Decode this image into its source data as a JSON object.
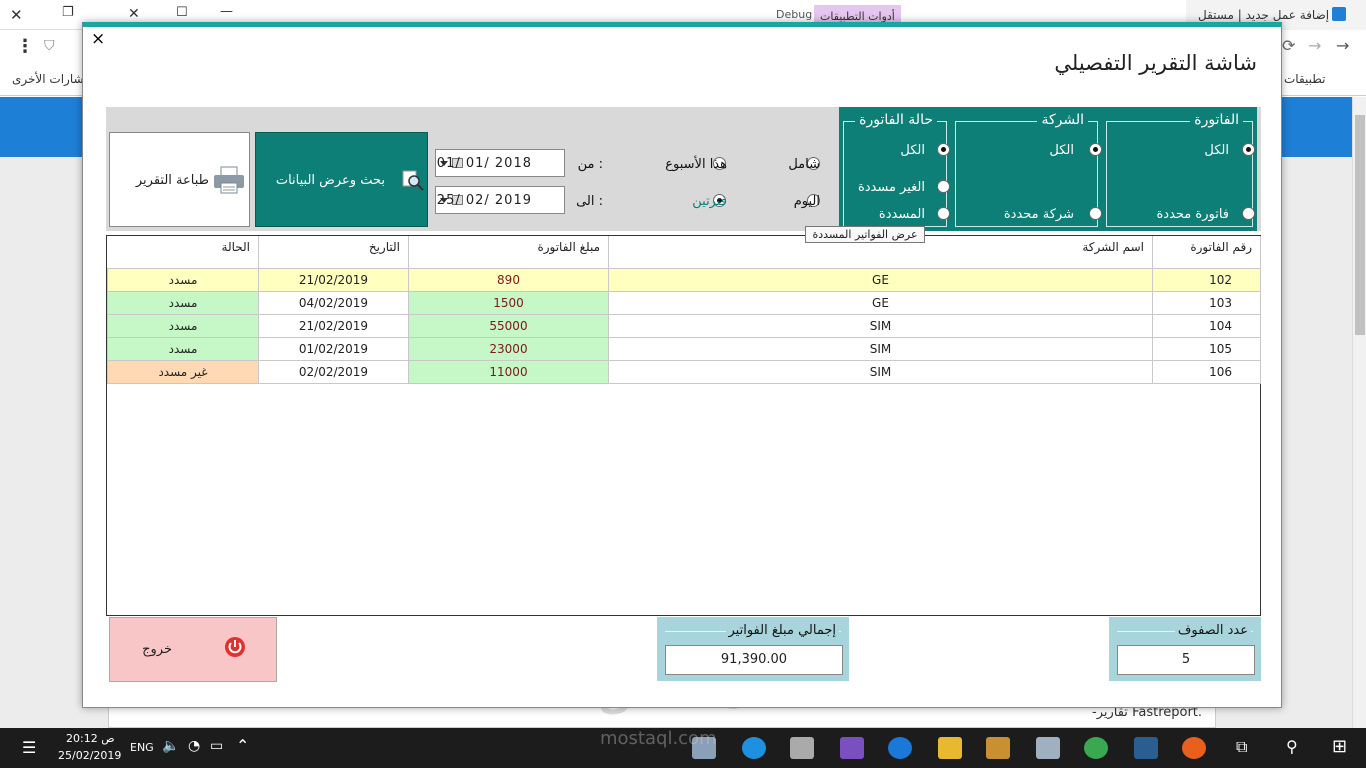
{
  "browser": {
    "tab1_title": "إضافة عمل جديد | مستقل",
    "tab2_title": "أدوات التطبيقات",
    "debug_label": "Debug",
    "bookmarks_apps": "تطبيقات",
    "bookmarks_other": "إشارات الأخرى",
    "page_snippet": "-تقارير Fastreport."
  },
  "window": {
    "close_label": "×",
    "title": "شاشة التقرير التفصيلي"
  },
  "filters": {
    "invoice": {
      "title": "الفاتورة",
      "all": "الكل",
      "specific": "فاتورة محددة"
    },
    "company": {
      "title": "الشركة",
      "all": "الكل",
      "specific": "شركة محددة"
    },
    "status": {
      "title": "حالة الفاتورة",
      "all": "الكل",
      "unpaid": "الغير مسددة",
      "paid": "المسددة"
    }
  },
  "period": {
    "all": "شامل",
    "this_week": "هذا الأسبوع",
    "today": "اليوم",
    "two_dates": "فترتين",
    "from_label": "من :",
    "to_label": "الى :",
    "from_date": "01/ 01/ 2018",
    "to_date": "25/ 02/ 2019"
  },
  "buttons": {
    "search": "بحث وعرض البيانات",
    "print": "طباعة التقرير",
    "exit": "خروج"
  },
  "tooltip": "عرض الفواتير المسددة",
  "table": {
    "headers": [
      "رقم الفاتورة",
      "اسم الشركة",
      "مبلغ الفاتورة",
      "التاريخ",
      "الحالة"
    ],
    "rows": [
      {
        "no": "102",
        "company": "GE",
        "amount": "890",
        "date": "21/02/2019",
        "status": "مسدد"
      },
      {
        "no": "103",
        "company": "GE",
        "amount": "1500",
        "date": "04/02/2019",
        "status": "مسدد"
      },
      {
        "no": "104",
        "company": "SIM",
        "amount": "55000",
        "date": "21/02/2019",
        "status": "مسدد"
      },
      {
        "no": "105",
        "company": "SIM",
        "amount": "23000",
        "date": "01/02/2019",
        "status": "مسدد"
      },
      {
        "no": "106",
        "company": "SIM",
        "amount": "11000",
        "date": "02/02/2019",
        "status": "غير مسدد"
      }
    ]
  },
  "summary": {
    "count_label": "عدد الصفوف",
    "count_value": "5",
    "total_label": "إجمالي مبلغ الفواتير",
    "total_value": "91,390.00"
  },
  "taskbar": {
    "time": "20:12 ص",
    "date": "25/02/2019",
    "lang": "ENG"
  },
  "watermark": {
    "arabic": "مستقل",
    "latin": "mostaql.com"
  },
  "colors": {
    "teal": "#0e7f76",
    "row_selected": "#ffffc0",
    "row_paid": "#c6f7c6",
    "row_unpaid": "#ffd9b3",
    "summary_bg": "#a8d4db",
    "exit_bg": "#f8c6c6"
  }
}
